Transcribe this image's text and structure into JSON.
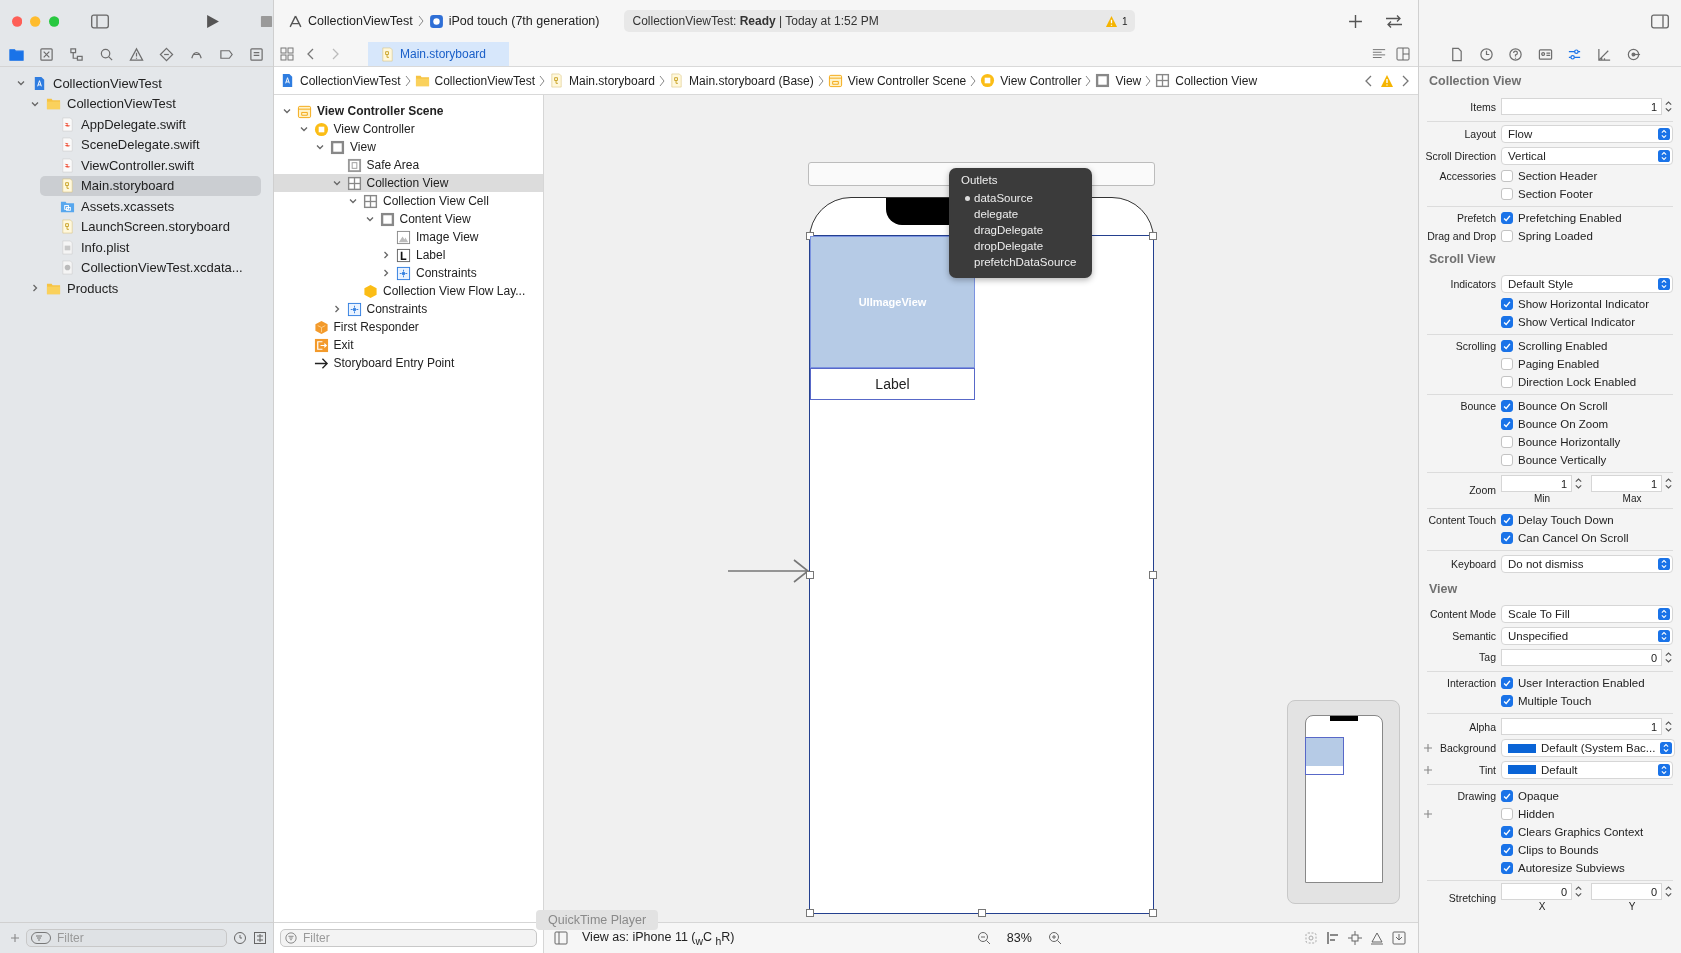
{
  "toolbar": {
    "scheme": "CollectionViewTest",
    "destination": "iPod touch (7th generation)",
    "status": "CollectionViewTest: **Ready** | Today at 1:52 PM",
    "warnings": "1"
  },
  "navigator_tabs": [
    {
      "kind": "folder",
      "selected": true
    },
    {
      "kind": "source",
      "selected": false
    },
    {
      "kind": "hierarchy",
      "selected": false
    },
    {
      "kind": "search",
      "selected": false
    },
    {
      "kind": "issue",
      "selected": false
    },
    {
      "kind": "test",
      "selected": false
    },
    {
      "kind": "debug",
      "selected": false
    },
    {
      "kind": "breakpoint",
      "selected": false
    },
    {
      "kind": "report",
      "selected": false
    }
  ],
  "navigator": [
    {
      "label": "CollectionViewTest",
      "kind": "project",
      "expanded": true,
      "selected": false,
      "children": [
        {
          "label": "CollectionViewTest",
          "kind": "folder",
          "expanded": true,
          "selected": false,
          "children": [
            {
              "label": "AppDelegate.swift",
              "kind": "swift",
              "selected": false
            },
            {
              "label": "SceneDelegate.swift",
              "kind": "swift",
              "selected": false
            },
            {
              "label": "ViewController.swift",
              "kind": "swift",
              "selected": false
            },
            {
              "label": "Main.storyboard",
              "kind": "storyboard",
              "selected": true
            },
            {
              "label": "Assets.xcassets",
              "kind": "assets",
              "selected": false
            },
            {
              "label": "LaunchScreen.storyboard",
              "kind": "storyboard",
              "selected": false
            },
            {
              "label": "Info.plist",
              "kind": "plist",
              "selected": false
            },
            {
              "label": "CollectionViewTest.xcdata...",
              "kind": "datamodel",
              "selected": false
            }
          ]
        },
        {
          "label": "Products",
          "kind": "folder",
          "expanded": false,
          "selected": false
        }
      ]
    }
  ],
  "navigator_filter": {
    "placeholder": "Filter"
  },
  "editor_tabs": [
    {
      "label": "Main.storyboard",
      "selected": true
    }
  ],
  "jump_bar": [
    {
      "label": "CollectionViewTest",
      "kind": "project"
    },
    {
      "label": "CollectionViewTest",
      "kind": "folder"
    },
    {
      "label": "Main.storyboard",
      "kind": "storyboard"
    },
    {
      "label": "Main.storyboard (Base)",
      "kind": "storyboard"
    },
    {
      "label": "View Controller Scene",
      "kind": "scene"
    },
    {
      "label": "View Controller",
      "kind": "controller"
    },
    {
      "label": "View",
      "kind": "view"
    },
    {
      "label": "Collection View",
      "kind": "collection"
    }
  ],
  "outline": [
    {
      "label": "View Controller Scene",
      "kind": "scene",
      "expanded": true,
      "selected": false,
      "children": [
        {
          "label": "View Controller",
          "kind": "controller",
          "expanded": true,
          "selected": false,
          "children": [
            {
              "label": "View",
              "kind": "view",
              "expanded": true,
              "selected": false,
              "children": [
                {
                  "label": "Safe Area",
                  "kind": "safearea",
                  "selected": false
                },
                {
                  "label": "Collection View",
                  "kind": "collection",
                  "expanded": true,
                  "selected": true,
                  "children": [
                    {
                      "label": "Collection View Cell",
                      "kind": "collection",
                      "expanded": true,
                      "selected": false,
                      "children": [
                        {
                          "label": "Content View",
                          "kind": "view",
                          "expanded": true,
                          "selected": false,
                          "children": [
                            {
                              "label": "Image View",
                              "kind": "image",
                              "selected": false
                            },
                            {
                              "label": "Label",
                              "kind": "label",
                              "expanded": false,
                              "selected": false
                            },
                            {
                              "label": "Constraints",
                              "kind": "constraints",
                              "expanded": false,
                              "selected": false
                            }
                          ]
                        }
                      ]
                    },
                    {
                      "label": "Collection View Flow Lay...",
                      "kind": "layout",
                      "selected": false
                    }
                  ]
                },
                {
                  "label": "Constraints",
                  "kind": "constraints",
                  "expanded": false,
                  "selected": false
                }
              ]
            }
          ]
        },
        {
          "label": "First Responder",
          "kind": "responder",
          "selected": false
        },
        {
          "label": "Exit",
          "kind": "exit",
          "selected": false
        },
        {
          "label": "Storyboard Entry Point",
          "kind": "entry",
          "selected": false
        }
      ]
    }
  ],
  "outline_filter": {
    "placeholder": "Filter"
  },
  "canvas": {
    "image_view": "UIImageView",
    "label": "Label",
    "outlets": {
      "title": "Outlets",
      "items": [
        {
          "label": "dataSource",
          "connected": true
        },
        {
          "label": "delegate",
          "connected": false
        },
        {
          "label": "dragDelegate",
          "connected": false
        },
        {
          "label": "dropDelegate",
          "connected": false
        },
        {
          "label": "prefetchDataSource",
          "connected": false
        }
      ]
    }
  },
  "canvas_bar": {
    "view_as": "View as: iPhone 11 ($_{w}$C $_{h}$R)",
    "zoom": "83%"
  },
  "dock_tooltip": "QuickTime Player",
  "inspector_tabs": [
    {
      "kind": "file",
      "selected": false
    },
    {
      "kind": "history",
      "selected": false
    },
    {
      "kind": "help",
      "selected": false
    },
    {
      "kind": "identity",
      "selected": false
    },
    {
      "kind": "attributes",
      "selected": true
    },
    {
      "kind": "size",
      "selected": false
    },
    {
      "kind": "connections",
      "selected": false
    }
  ],
  "inspector": [
    {
      "title": "Collection View",
      "groups": [
        [
          {
            "kind": "stepper",
            "label": "Items",
            "value": "1"
          }
        ],
        [
          {
            "kind": "popup",
            "label": "Layout",
            "value": "Flow"
          },
          {
            "kind": "popup",
            "label": "Scroll Direction",
            "value": "Vertical"
          },
          {
            "kind": "check",
            "label": "Accessories",
            "text": "Section Header",
            "checked": false
          },
          {
            "kind": "check",
            "text": "Section Footer",
            "checked": false
          }
        ],
        [
          {
            "kind": "check",
            "label": "Prefetch",
            "text": "Prefetching Enabled",
            "checked": true
          },
          {
            "kind": "check",
            "label": "Drag and Drop",
            "text": "Spring Loaded",
            "checked": false
          }
        ]
      ]
    },
    {
      "title": "Scroll View",
      "groups": [
        [
          {
            "kind": "popup",
            "label": "Indicators",
            "value": "Default Style"
          },
          {
            "kind": "check",
            "text": "Show Horizontal Indicator",
            "checked": true
          },
          {
            "kind": "check",
            "text": "Show Vertical Indicator",
            "checked": true
          }
        ],
        [
          {
            "kind": "check",
            "label": "Scrolling",
            "text": "Scrolling Enabled",
            "checked": true
          },
          {
            "kind": "check",
            "text": "Paging Enabled",
            "checked": false
          },
          {
            "kind": "check",
            "text": "Direction Lock Enabled",
            "checked": false
          }
        ],
        [
          {
            "kind": "check",
            "label": "Bounce",
            "text": "Bounce On Scroll",
            "checked": true
          },
          {
            "kind": "check",
            "text": "Bounce On Zoom",
            "checked": true
          },
          {
            "kind": "check",
            "text": "Bounce Horizontally",
            "checked": false
          },
          {
            "kind": "check",
            "text": "Bounce Vertically",
            "checked": false
          }
        ],
        [
          {
            "kind": "pair",
            "label": "Zoom",
            "fields": [
              {
                "value": "1",
                "caption": "Min"
              },
              {
                "value": "1",
                "caption": "Max"
              }
            ]
          }
        ],
        [
          {
            "kind": "check",
            "label": "Content Touch",
            "text": "Delay Touch Down",
            "checked": true
          },
          {
            "kind": "check",
            "text": "Can Cancel On Scroll",
            "checked": true
          }
        ],
        [
          {
            "kind": "popup",
            "label": "Keyboard",
            "value": "Do not dismiss"
          }
        ]
      ]
    },
    {
      "title": "View",
      "groups": [
        [
          {
            "kind": "popup",
            "label": "Content Mode",
            "value": "Scale To Fill"
          },
          {
            "kind": "popup",
            "label": "Semantic",
            "value": "Unspecified"
          },
          {
            "kind": "stepper",
            "label": "Tag",
            "value": "0"
          }
        ],
        [
          {
            "kind": "check",
            "label": "Interaction",
            "text": "User Interaction Enabled",
            "checked": true
          },
          {
            "kind": "check",
            "text": "Multiple Touch",
            "checked": true
          }
        ],
        [
          {
            "kind": "stepper",
            "label": "Alpha",
            "value": "1"
          },
          {
            "kind": "color",
            "label": "Background",
            "value": "Default (System Bac...",
            "color": "#0a64d6",
            "plus": true
          },
          {
            "kind": "color",
            "label": "Tint",
            "value": "Default",
            "color": "#0a64d6",
            "plus": true
          }
        ],
        [
          {
            "kind": "check",
            "label": "Drawing",
            "text": "Opaque",
            "checked": true
          },
          {
            "kind": "check",
            "text": "Hidden",
            "checked": false,
            "plus": true
          },
          {
            "kind": "check",
            "text": "Clears Graphics Context",
            "checked": true
          },
          {
            "kind": "check",
            "text": "Clips to Bounds",
            "checked": true
          },
          {
            "kind": "check",
            "text": "Autoresize Subviews",
            "checked": true
          }
        ],
        [
          {
            "kind": "pair",
            "label": "Stretching",
            "fields": [
              {
                "value": "0",
                "caption": "X"
              },
              {
                "value": "0",
                "caption": "Y"
              }
            ]
          }
        ]
      ]
    }
  ]
}
